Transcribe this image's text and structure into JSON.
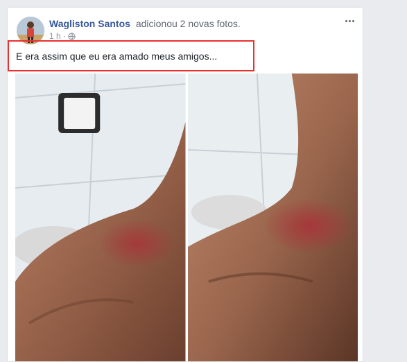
{
  "post": {
    "author": "Wagliston Santos",
    "action": "adicionou 2 novas fotos.",
    "time": "1 h",
    "separator": "·",
    "privacy_icon": "globe-icon",
    "menu_icon": "more-options-icon",
    "text": "E era assim que eu era amado meus amigos...",
    "highlight_color": "#e8302e",
    "author_color": "#365899",
    "photos": [
      {
        "name": "photo-1"
      },
      {
        "name": "photo-2"
      }
    ]
  }
}
